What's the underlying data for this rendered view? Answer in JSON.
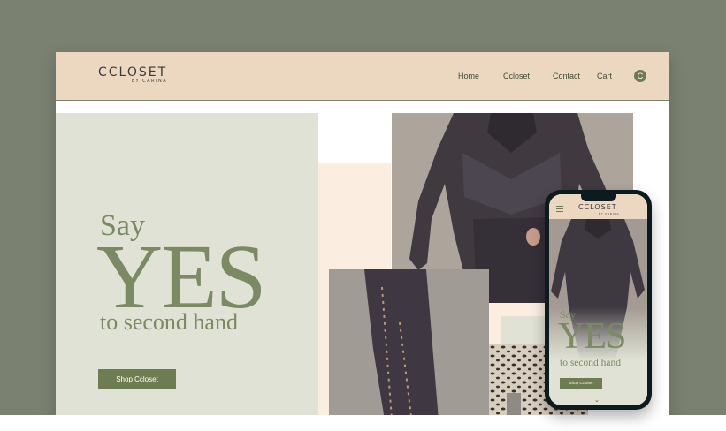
{
  "header": {
    "logo": "CCLOSET",
    "logo_sub": "BY CARINA",
    "nav": [
      "Home",
      "Ccloset",
      "Contact",
      "Cart"
    ],
    "avatar_initial": "C"
  },
  "hero": {
    "say": "Say",
    "yes": "YES",
    "tagline": "to second hand",
    "cta": "Shop Ccloset"
  },
  "mobile": {
    "logo": "CCLOSET",
    "logo_sub": "BY CARINA",
    "say": "Say",
    "yes": "YES",
    "tagline": "to second hand",
    "cta": "Shop Ccloset"
  },
  "colors": {
    "background": "#7b8171",
    "header": "#ecd7c1",
    "hero_panel": "#dfe2d4",
    "accent_green": "#6e7c52",
    "peach": "#fbeee1"
  },
  "icons": [
    "menu-icon",
    "chevron-down-icon",
    "avatar-icon"
  ]
}
